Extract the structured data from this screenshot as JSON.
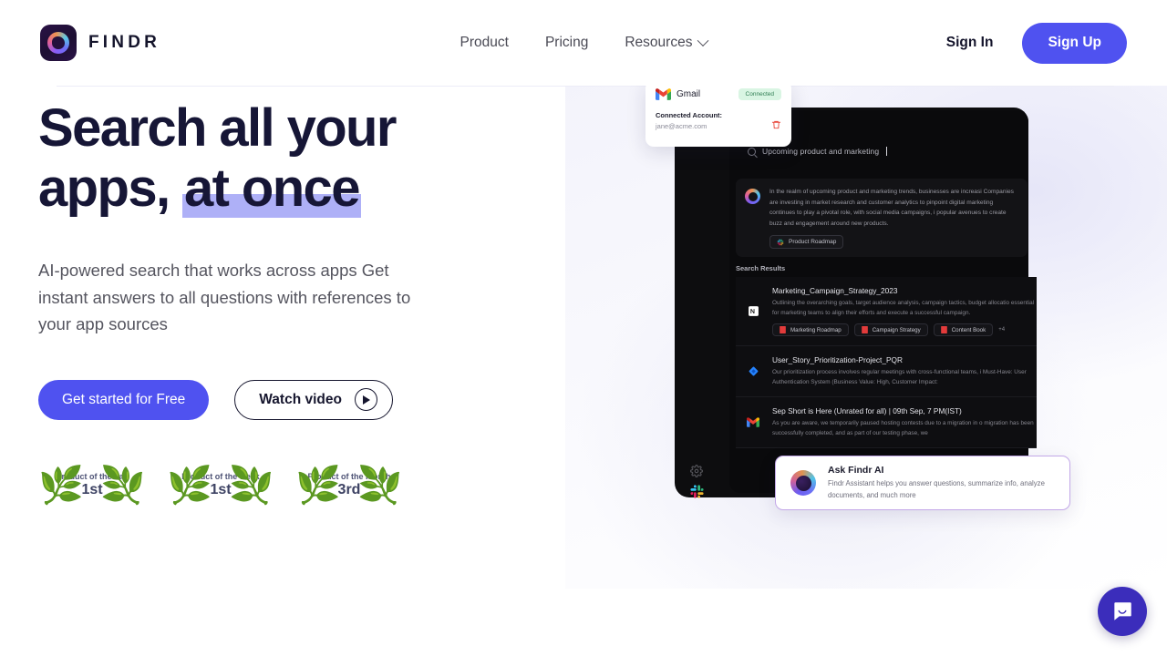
{
  "header": {
    "brand_name": "FINDR",
    "nav": [
      {
        "label": "Product",
        "has_chevron": false
      },
      {
        "label": "Pricing",
        "has_chevron": false
      },
      {
        "label": "Resources",
        "has_chevron": true
      }
    ],
    "sign_in": "Sign In",
    "sign_up": "Sign Up",
    "accent_color": "#4f52f0"
  },
  "hero": {
    "headline_part1": "Search all your apps, ",
    "headline_highlight": "at once",
    "highlight_color": "#aeb0f7",
    "subhead": "AI-powered search that works across apps Get instant answers to all questions with references to your app sources",
    "cta_primary": "Get started for Free",
    "cta_secondary": "Watch video",
    "badges": [
      {
        "title": "Product of the day",
        "rank": "1st"
      },
      {
        "title": "Product of the week",
        "rank": "1st"
      },
      {
        "title": "Product of the month",
        "rank": "3rd"
      }
    ]
  },
  "gmail_card": {
    "app_name": "Gmail",
    "status": "Connected",
    "status_color": "#2f7d52",
    "account_label": "Connected Account:",
    "account_email": "jane@acme.com"
  },
  "app_mock": {
    "search_value": "Upcoming product and marketing",
    "ai_answer": "In the realm of upcoming product and marketing trends, businesses are increasi Companies are investing in market research and customer analytics to pinpoint digital marketing continues to play a pivotal role, with social media campaigns, i popular avenues to create buzz and engagement around new products.",
    "ai_chip": "Product Roadmap",
    "results_label": "Search Results",
    "results": [
      {
        "icon": "notion-icon",
        "title": "Marketing_Campaign_Strategy_2023",
        "snippet": "Outlining the overarching goals, target audience analysis, campaign tactics, budget allocatio essential for marketing teams to align their efforts and execute a successful campaign.",
        "chips": [
          "Marketing Roadmap",
          "Campaign Strategy",
          "Content Book"
        ],
        "more": "+4"
      },
      {
        "icon": "jira-icon",
        "title": "User_Story_Prioritization-Project_PQR",
        "snippet": "Our prioritization process involves regular meetings with cross-functional teams, i Must-Have: User Authentication System (Business Value: High, Customer Impact:",
        "chips": [],
        "more": ""
      },
      {
        "icon": "gmail-icon",
        "title": "Sep Short is Here (Unrated for all) | 09th Sep, 7 PM(IST)",
        "snippet": "As you are aware, we temporarily paused hosting contests due to a migration in o migration has been successfully completed, and as part of our testing phase, we",
        "chips": [],
        "more": ""
      }
    ]
  },
  "ask_card": {
    "title": "Ask Findr AI",
    "subtitle": "Findr Assistant helps you answer questions, summarize info, analyze documents, and much more",
    "border_color": "#c3a8e8"
  },
  "chat_widget": {
    "color": "#3b2dbb"
  }
}
